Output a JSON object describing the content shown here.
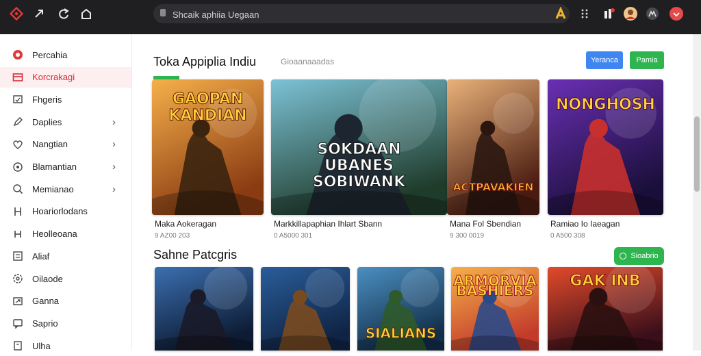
{
  "browser": {
    "search_placeholder": "Shcaik aphiia Uegaan"
  },
  "sidebar": {
    "items": [
      {
        "label": "Percahia",
        "icon": "app-logo-icon",
        "active": false,
        "chevron": false
      },
      {
        "label": "Korcrakagi",
        "icon": "storefront-icon",
        "active": true,
        "chevron": false
      },
      {
        "label": "Fhgeris",
        "icon": "tag-icon",
        "active": false,
        "chevron": false
      },
      {
        "label": "Daplies",
        "icon": "pen-icon",
        "active": false,
        "chevron": true
      },
      {
        "label": "Nangtian",
        "icon": "heart-icon",
        "active": false,
        "chevron": true
      },
      {
        "label": "Blamantian",
        "icon": "gamepad-icon",
        "active": false,
        "chevron": true
      },
      {
        "label": "Memianao",
        "icon": "magnifier-icon",
        "active": false,
        "chevron": true
      },
      {
        "label": "Hoariorlodans",
        "icon": "h-icon",
        "active": false,
        "chevron": false
      },
      {
        "label": "Heolleoana",
        "icon": "h-box-icon",
        "active": false,
        "chevron": false
      },
      {
        "label": "Aliaf",
        "icon": "list-icon",
        "active": false,
        "chevron": false
      },
      {
        "label": "Oilaode",
        "icon": "settings-icon",
        "active": false,
        "chevron": false
      },
      {
        "label": "Ganna",
        "icon": "export-icon",
        "active": false,
        "chevron": false
      },
      {
        "label": "Saprio",
        "icon": "chat-icon",
        "active": false,
        "chevron": false
      },
      {
        "label": "Ulha",
        "icon": "info-icon",
        "active": false,
        "chevron": false
      }
    ]
  },
  "featured": {
    "title": "Toka Appiplia Indiu",
    "subtitle": "Gioaanaaadas",
    "button_primary": "Yeranca",
    "button_secondary": "Pamia",
    "cards": [
      {
        "title": "Maka Aokeragan",
        "meta": "9 AZ00 203",
        "poster_text": [
          "GAOPAN",
          "KANDIAN"
        ],
        "theme": "amber"
      },
      {
        "title": "Markkillapaphian  Ihlart Sbann",
        "meta": "0 A5000 301",
        "poster_text": [
          "SOKDAAN",
          "UBANES",
          "SOBIWANK"
        ],
        "theme": "forest"
      },
      {
        "title": "Mana Fol Sbendian",
        "meta": "9 300 0019",
        "poster_text": [
          "ACTPAVAKIEN"
        ],
        "theme": "ember"
      },
      {
        "title": "Ramiao Io Iaeagan",
        "meta": "0 A500 308",
        "poster_text": [
          "NONGHOSH"
        ],
        "theme": "cosmic"
      }
    ]
  },
  "categories": {
    "title": "Sahne Patcgris",
    "button": "Sioabrio",
    "cards": [
      {
        "poster_text": [],
        "theme": "storm"
      },
      {
        "poster_text": [],
        "theme": "dwarf"
      },
      {
        "poster_text": [
          "SIALIANS"
        ],
        "theme": "soldier"
      },
      {
        "poster_text": [
          "ARMORVIA",
          "BASHIERS"
        ],
        "theme": "sunset"
      },
      {
        "poster_text": [
          "GAK INB"
        ],
        "theme": "inferno"
      }
    ]
  },
  "colors": {
    "topbar": "#1f1f22",
    "accent_red": "#d62b36",
    "button_blue": "#3f86f1",
    "button_green": "#2fb54f",
    "active_bg": "#fdeff0"
  }
}
